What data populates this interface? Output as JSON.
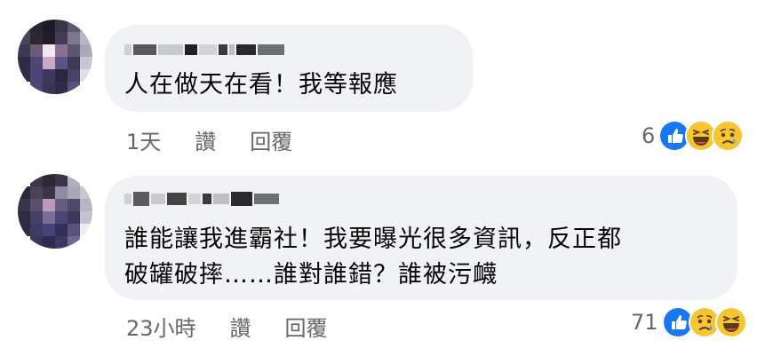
{
  "comments": [
    {
      "author_name": "",
      "text": "人在做天在看！我等報應",
      "time": "1天",
      "like_label": "讚",
      "reply_label": "回覆",
      "reaction_count": "6",
      "reactions": [
        "like-icon",
        "haha-icon",
        "sad-icon"
      ]
    },
    {
      "author_name": "",
      "text": "誰能讓我進霸社！我要曝光很多資訊，反正都\n破罐破摔……誰對誰錯？誰被污衊",
      "time": "23小時",
      "like_label": "讚",
      "reply_label": "回覆",
      "reaction_count": "71",
      "reactions": [
        "like-icon",
        "sad-icon",
        "haha-icon"
      ]
    }
  ],
  "colors": {
    "bubble_bg": "#f0f2f5",
    "meta_text": "#65676b",
    "like_blue": "#1877f2",
    "emoji_yellow": "#f7c532"
  }
}
